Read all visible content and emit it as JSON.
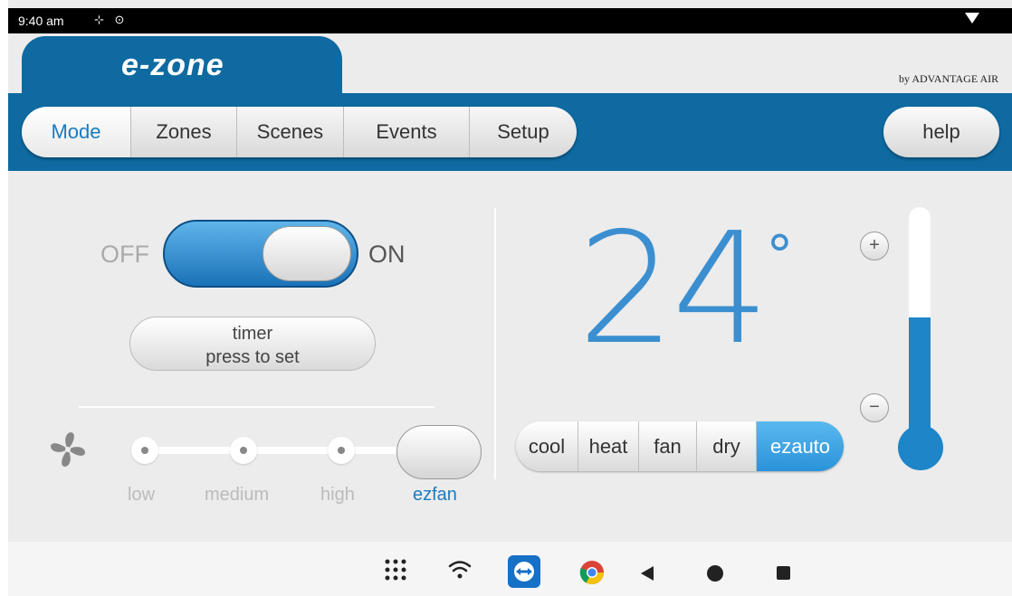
{
  "status_bar": {
    "time": "9:40 am",
    "icons": "⊹ ⊙"
  },
  "header": {
    "logo": "e-zone",
    "brand": "by ADVANTAGE AIR"
  },
  "nav": {
    "tabs": [
      {
        "label": "Mode",
        "active": true
      },
      {
        "label": "Zones",
        "active": false
      },
      {
        "label": "Scenes",
        "active": false
      },
      {
        "label": "Events",
        "active": false
      },
      {
        "label": "Setup",
        "active": false
      }
    ],
    "help_label": "help"
  },
  "power": {
    "off_label": "OFF",
    "on_label": "ON",
    "state": "ON"
  },
  "timer": {
    "line1": "timer",
    "line2": "press to set"
  },
  "fan": {
    "levels": [
      "low",
      "medium",
      "high",
      "ezfan"
    ],
    "selected": "ezfan"
  },
  "temperature": {
    "value": "24",
    "unit": "°",
    "level_fraction": 0.55
  },
  "modes": {
    "options": [
      "cool",
      "heat",
      "fan",
      "dry",
      "ezauto"
    ],
    "selected": "ezauto"
  },
  "controls": {
    "increase": "+",
    "decrease": "−"
  },
  "colors": {
    "primary": "#0e6aa1",
    "accent": "#1a7bc0",
    "active_mode": "#2a93d9"
  },
  "system_nav": {
    "icons": [
      "apps-grid-icon",
      "wifi-icon",
      "teamviewer-icon",
      "chrome-icon",
      "back-icon",
      "home-icon",
      "recents-icon"
    ]
  }
}
